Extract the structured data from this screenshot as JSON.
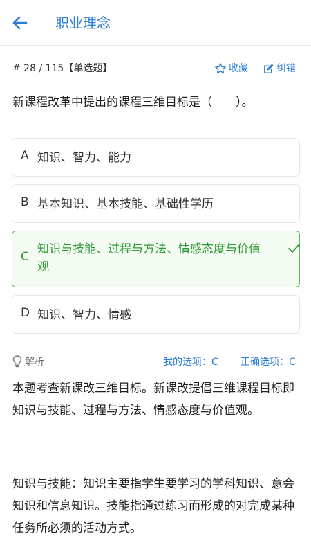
{
  "header": {
    "title": "职业理念"
  },
  "question_meta": {
    "progress": "# 28 / 115",
    "type": "【单选题】"
  },
  "actions": {
    "favorite_label": "收藏",
    "correction_label": "纠错"
  },
  "question": {
    "text": "新课程改革中提出的课程三维目标是（　　）。"
  },
  "options": [
    {
      "letter": "A",
      "text": "知识、智力、能力"
    },
    {
      "letter": "B",
      "text": "基本知识、基本技能、基础性学历"
    },
    {
      "letter": "C",
      "text": "知识与技能、过程与方法、情感态度与价值观",
      "selected": true,
      "correct": true
    },
    {
      "letter": "D",
      "text": "知识、智力、情感"
    }
  ],
  "analysis": {
    "label": "解析",
    "my_choice": "我的选项：C",
    "correct_answer": "正确选项：C",
    "paragraphs": [
      "本题考查新课改三维目标。新课改提倡三维课程目标即知识与技能、过程与方法、情感态度与价值观。",
      "知识与技能：知识主要指学生要学习的学科知识、意会知识和信息知识。技能指通过练习而形成的对完成某种任务所必须的活动方式。"
    ]
  },
  "colors": {
    "accent": "#2b7cd3",
    "correct": "#2f9a35",
    "correct_bg": "#f4fbf3"
  }
}
